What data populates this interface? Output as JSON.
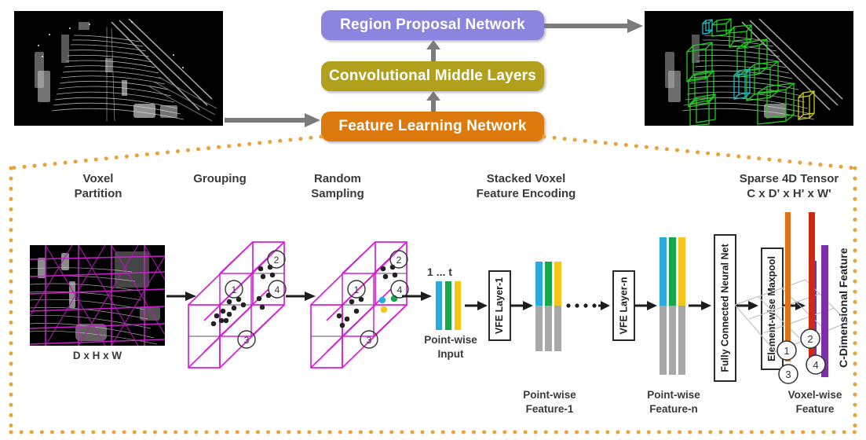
{
  "pipeline": {
    "boxes": [
      {
        "id": "region-proposal-network",
        "label": "Region Proposal Network",
        "color": "#8b85e0"
      },
      {
        "id": "convolutional-middle-layers",
        "label": "Convolutional Middle Layers",
        "color": "#b0a01c"
      },
      {
        "id": "feature-learning-network",
        "label": "Feature Learning Network",
        "color": "#dd7a0d"
      }
    ]
  },
  "input_cloud": {
    "name": "input-point-cloud"
  },
  "output_cloud": {
    "name": "detection-result-point-cloud",
    "box_colors": {
      "car": "#22cc22",
      "pedestrian": "#22bbcc",
      "cyclist": "#cccc22"
    }
  },
  "stages": [
    {
      "id": "voxel-partition",
      "title": "Voxel\nPartition"
    },
    {
      "id": "grouping",
      "title": "Grouping"
    },
    {
      "id": "random-sampling",
      "title": "Random\nSampling"
    },
    {
      "id": "stacked-vfe",
      "title": "Stacked Voxel\nFeature Encoding"
    },
    {
      "id": "sparse-tensor",
      "title": "Sparse 4D Tensor\nC x D' x H' x W'"
    }
  ],
  "captions": {
    "voxel_dims": "D x H x W",
    "pointwise_input": "Point-wise\nInput",
    "pointwise_feature_1": "Point-wise\nFeature-1",
    "pointwise_feature_n": "Point-wise\nFeature-n",
    "voxelwise_feature": "Voxel-wise\nFeature",
    "index_range": "1 ... t"
  },
  "modules": {
    "vfe_layer_1": "VFE Layer-1",
    "vfe_layer_n": "VFE Layer-n",
    "fully_connected": "Fully Connected Neural Net",
    "maxpool": "Element-wise Maxpool"
  },
  "c_dimensional_feature_label": "C-Dimensional Feature",
  "voxel_indices": [
    "1",
    "2",
    "3",
    "4"
  ],
  "colors": {
    "dotted_border": "#e8a33d",
    "voxel_grid": "#d81fd8",
    "feature_cyan": "#29abe2",
    "feature_green": "#15a84a",
    "feature_yellow": "#f5c518",
    "feature_gray": "#a8a8a8",
    "voxel_feature_purple": "#7b2fa8",
    "tensor_bar_orange": "#e0701a",
    "tensor_bar_red": "#cc2a12",
    "tensor_bar_purple": "#7b2fa8",
    "arrow_gray": "#7b7b7b",
    "arrow_black": "#1d1d1d"
  },
  "tensor_columns": [
    {
      "index": "1",
      "color": "#e0701a"
    },
    {
      "index": "2",
      "color": "#cc2a12"
    },
    {
      "index": "4",
      "color": "#7b2fa8"
    }
  ]
}
